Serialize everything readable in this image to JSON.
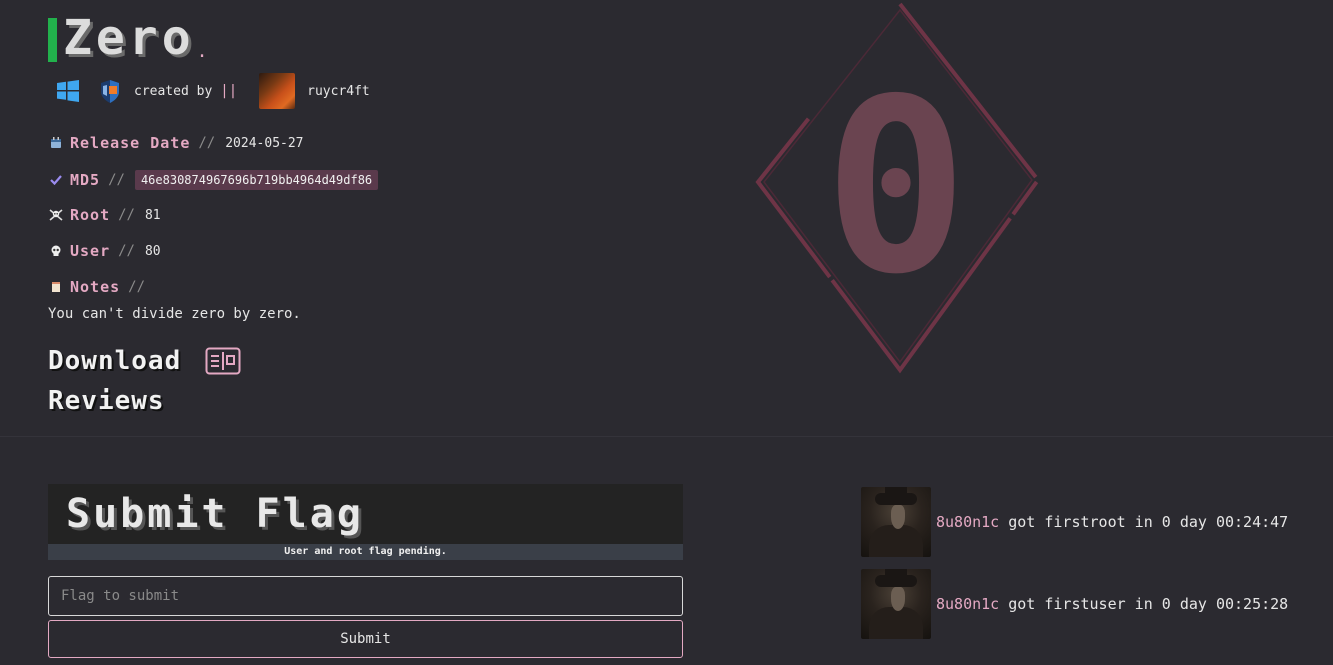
{
  "machine": {
    "name": "Zero",
    "title_suffix": ".",
    "created_by_label": "created by",
    "separator": "||",
    "author": "ruycr4ft",
    "os_icon": "windows-icon",
    "platform_icon": "hyperv-icon"
  },
  "meta": {
    "release": {
      "icon": "calendar-icon",
      "label": "Release Date",
      "slashes": "//",
      "value": "2024-05-27"
    },
    "md5": {
      "icon": "check-icon",
      "label": "MD5",
      "slashes": "//",
      "value": "46e830874967696b719bb4964d49df86"
    },
    "root": {
      "icon": "skull-crossbones-icon",
      "label": "Root",
      "slashes": "//",
      "value": "81"
    },
    "user": {
      "icon": "skull-icon",
      "label": "User",
      "slashes": "//",
      "value": "80"
    },
    "notes": {
      "icon": "note-icon",
      "label": "Notes",
      "slashes": "//",
      "value": "You can't divide zero by zero."
    }
  },
  "download_label": "Download",
  "reviews_label": "Reviews",
  "logo_glyph": "0",
  "submit": {
    "title": "Submit Flag",
    "status": "User and root flag pending.",
    "placeholder": "Flag to submit",
    "button_label": "Submit"
  },
  "feed": [
    {
      "user": "8u80n1c",
      "text": " got firstroot in 0 day 00:24:47"
    },
    {
      "user": "8u80n1c",
      "text": " got firstuser in 0 day 00:25:28"
    }
  ],
  "colors": {
    "accent_pink": "#e4a9c3",
    "title_bar_green": "#22b14c",
    "background": "#2b2a30",
    "logo_red": "#6e3446"
  }
}
